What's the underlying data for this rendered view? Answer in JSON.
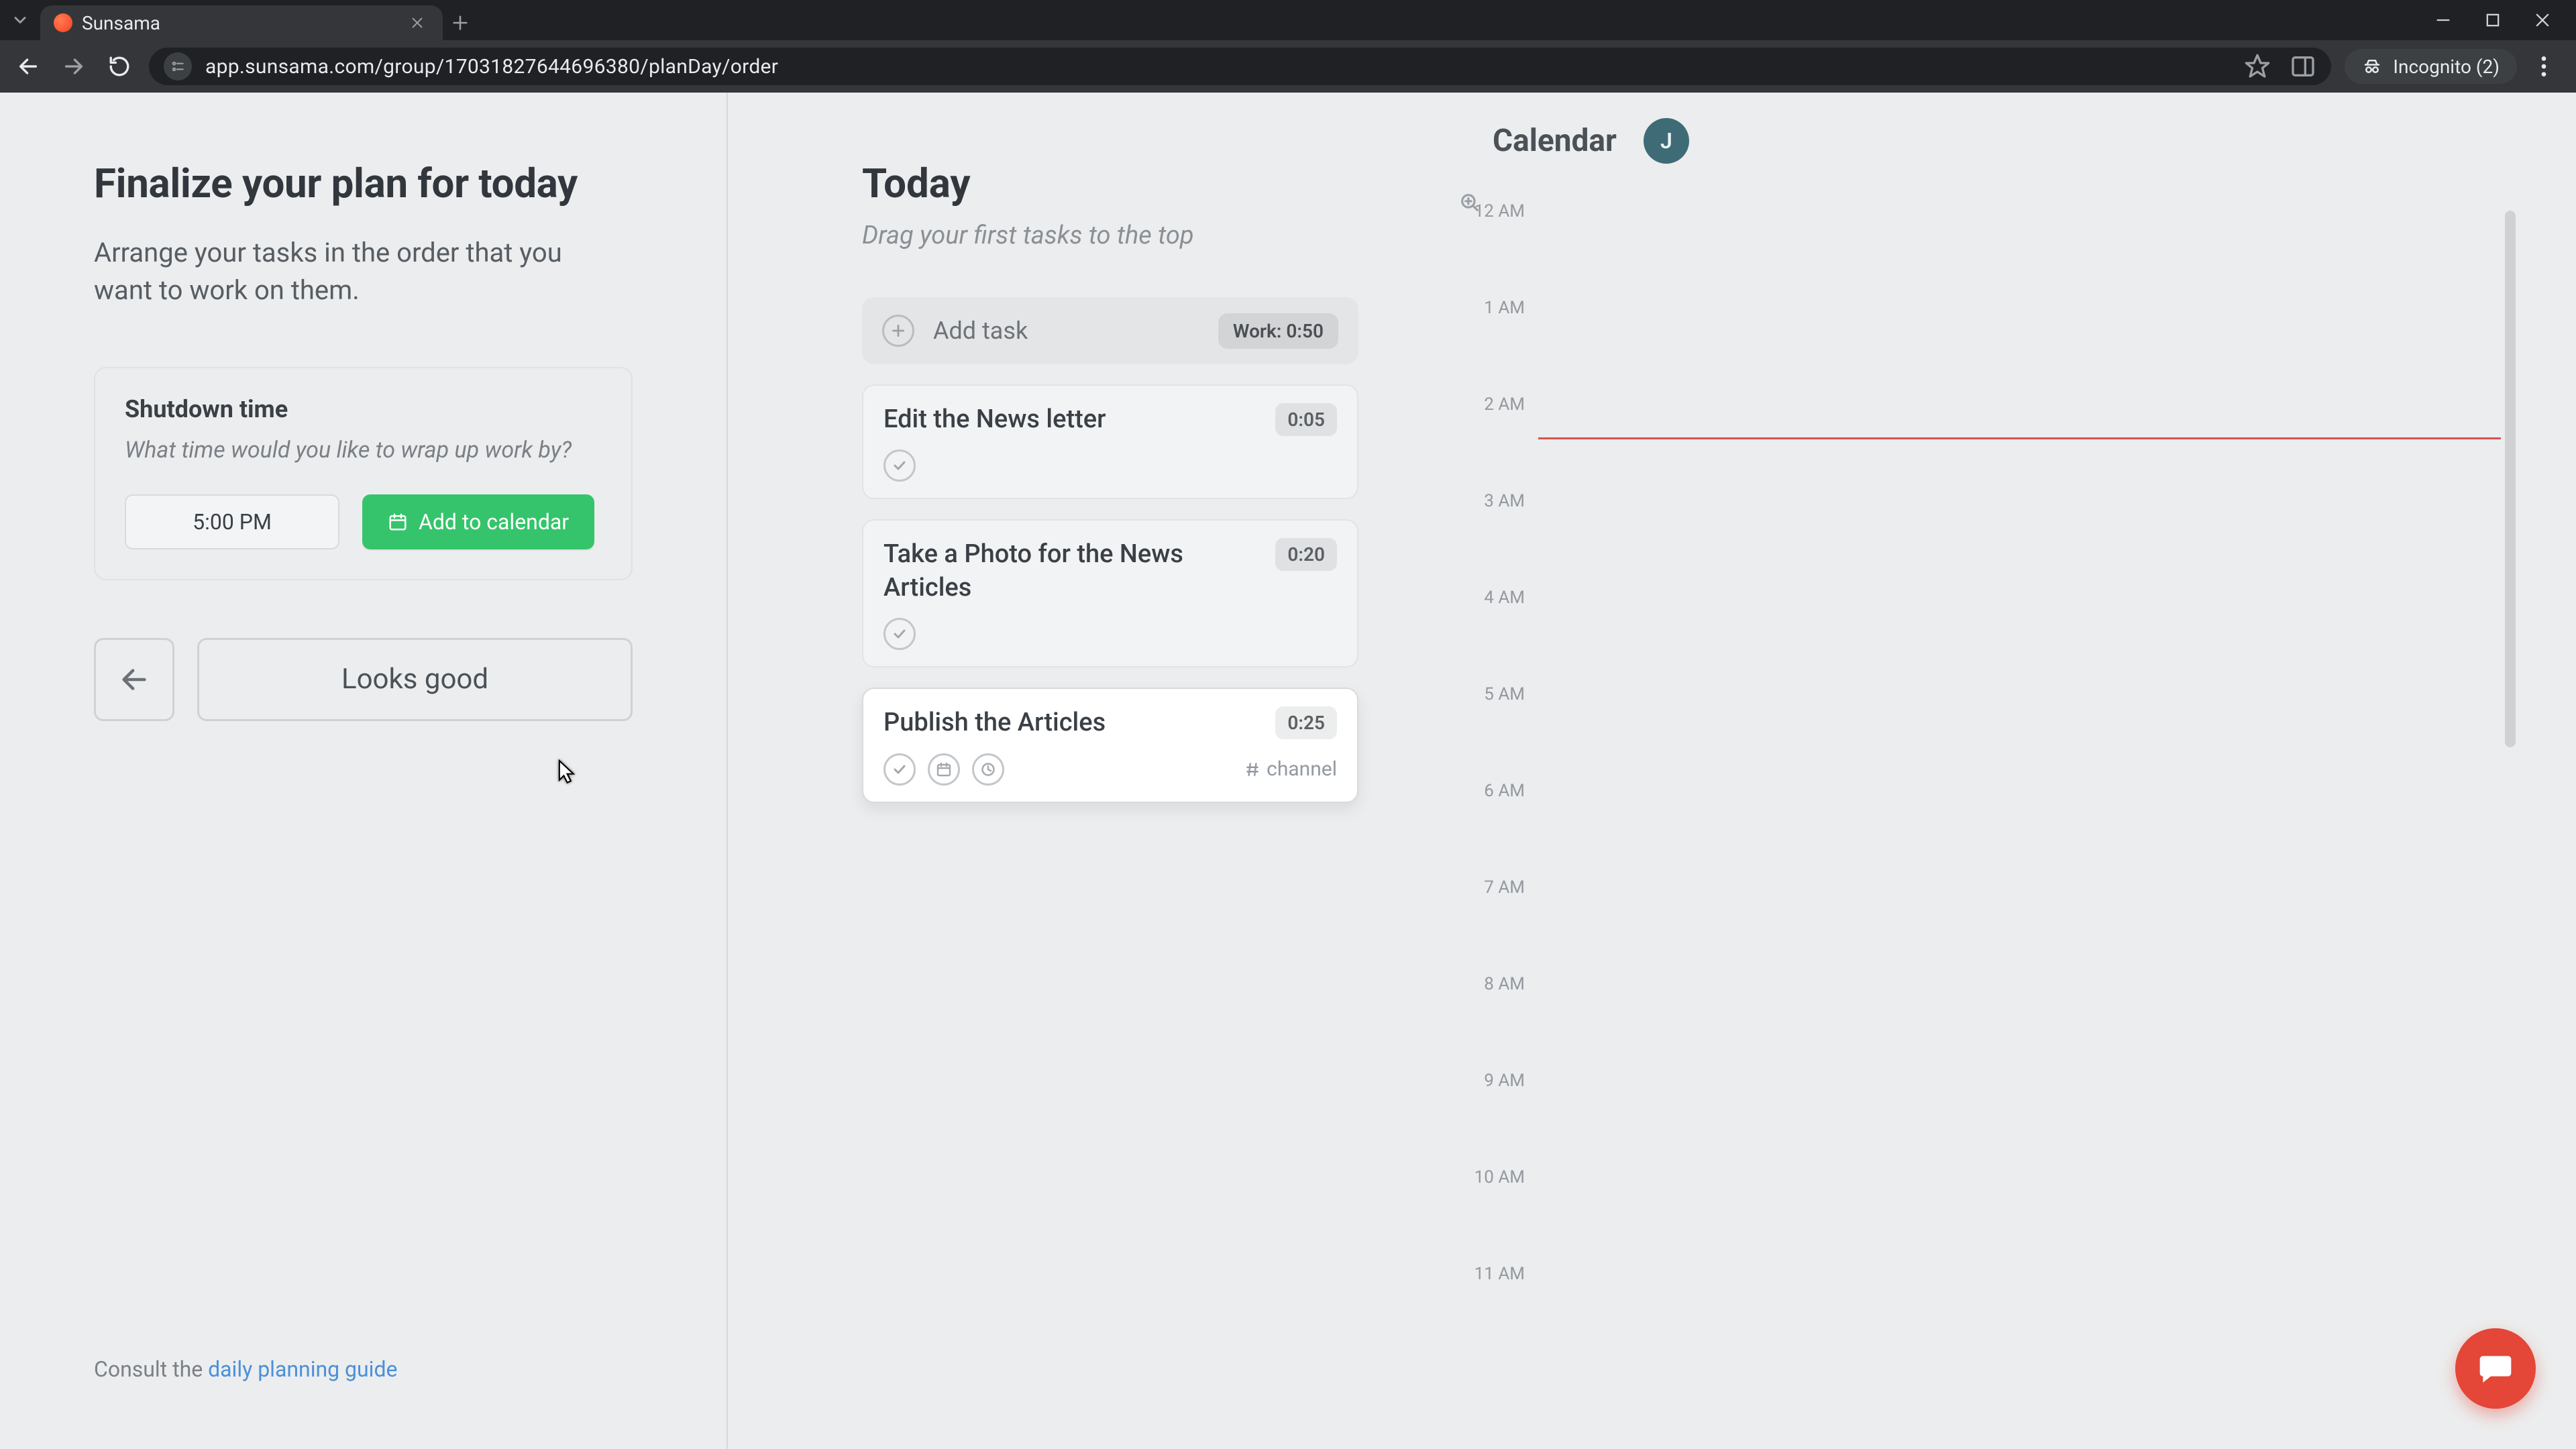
{
  "browser": {
    "tab_title": "Sunsama",
    "url": "app.sunsama.com/group/17031827644696380/planDay/order",
    "incognito_label": "Incognito (2)"
  },
  "left": {
    "title": "Finalize your plan for today",
    "subtitle": "Arrange your tasks in the order that you want to work on them.",
    "shutdown": {
      "heading": "Shutdown time",
      "prompt": "What time would you like to wrap up work by?",
      "time_value": "5:00 PM",
      "add_label": "Add to calendar"
    },
    "looks_good": "Looks good",
    "footer_prefix": "Consult the ",
    "footer_link": "daily planning guide"
  },
  "center": {
    "title": "Today",
    "subtitle": "Drag your first tasks to the top",
    "add_task_label": "Add task",
    "work_pill": "Work: 0:50",
    "tasks": [
      {
        "title": "Edit the News letter",
        "duration": "0:05"
      },
      {
        "title": "Take a Photo for the News Articles",
        "duration": "0:20"
      },
      {
        "title": "Publish the Articles",
        "duration": "0:25",
        "channel": "channel"
      }
    ]
  },
  "calendar": {
    "title": "Calendar",
    "avatar_initial": "J",
    "hours": [
      "12 AM",
      "1 AM",
      "2 AM",
      "3 AM",
      "4 AM",
      "5 AM",
      "6 AM",
      "7 AM",
      "8 AM",
      "9 AM",
      "10 AM",
      "11 AM"
    ],
    "now_hour_index": 2.35
  },
  "colors": {
    "accent_green": "#35c46b",
    "help_red": "#e44637",
    "now_line": "#d9534f",
    "avatar_bg": "#3f6b76"
  }
}
